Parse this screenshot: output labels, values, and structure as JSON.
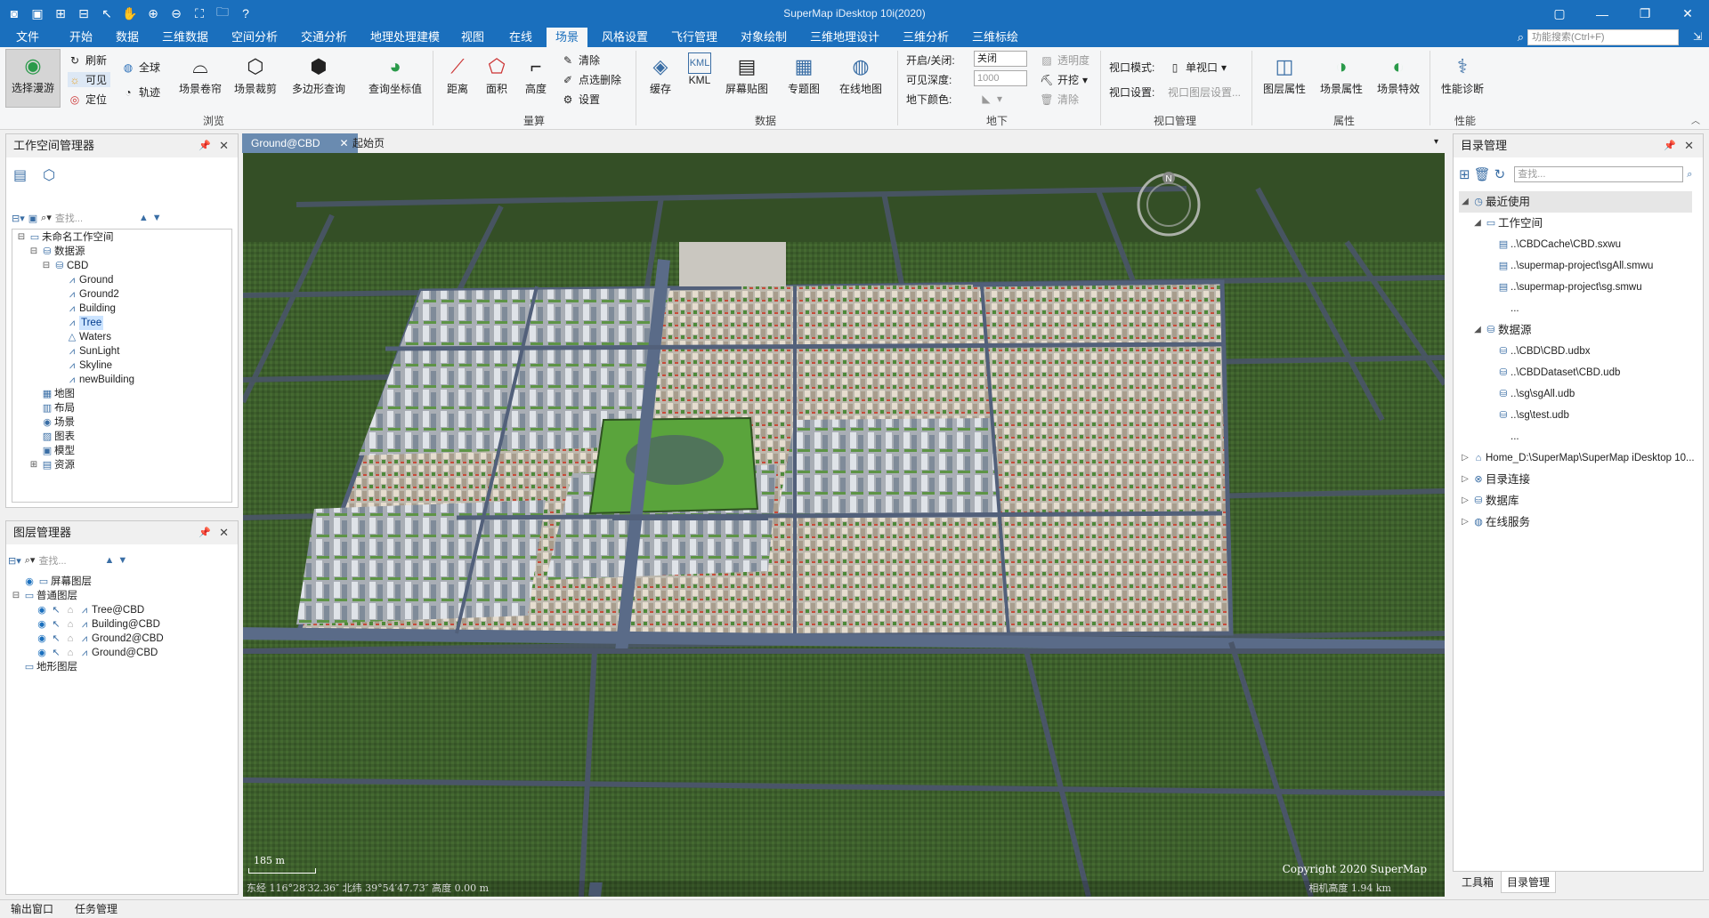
{
  "title": "SuperMap iDesktop 10i(2020)",
  "menu": [
    "文件",
    "开始",
    "数据",
    "三维数据",
    "空间分析",
    "交通分析",
    "地理处理建模",
    "视图",
    "在线",
    "场景",
    "风格设置",
    "飞行管理",
    "对象绘制",
    "三维地理设计",
    "三维分析",
    "三维标绘"
  ],
  "active_menu": "场景",
  "search_placeholder": "功能搜索(Ctrl+F)",
  "ribbon": {
    "browse": {
      "select_roam": "选择漫游",
      "refresh": "刷新",
      "visible": "可见",
      "locate": "定位",
      "globe": "全球",
      "track": "轨迹",
      "scene_roll": "场景卷帘",
      "scene_clip": "场景裁剪",
      "polygon_query": "多边形查询",
      "query_coord": "查询坐标值",
      "group": "浏览"
    },
    "measure": {
      "distance": "距离",
      "area": "面积",
      "height": "高度",
      "clear": "清除",
      "clear_point": "点选删除",
      "settings": "设置",
      "group": "量算"
    },
    "data": {
      "cache": "缓存",
      "kml": "KML",
      "screen_map": "屏幕贴图",
      "thematic": "专题图",
      "online_map": "在线地图",
      "group": "数据"
    },
    "underground": {
      "toggle_label": "开启/关闭:",
      "toggle_value": "关闭",
      "depth_label": "可见深度:",
      "depth_value": "1000",
      "color_label": "地下颜色:",
      "transparency": "透明度",
      "excavate": "开挖",
      "clear": "清除",
      "group": "地下"
    },
    "viewport": {
      "mode_label": "视口模式:",
      "mode_value": "单视口",
      "settings_label": "视口设置:",
      "settings_value": "视口图层设置...",
      "group": "视口管理"
    },
    "props": {
      "layer_props": "图层属性",
      "scene_props": "场景属性",
      "scene_effects": "场景特效",
      "group": "属性"
    },
    "perf": {
      "diagnose": "性能诊断",
      "group": "性能"
    }
  },
  "workspace": {
    "title": "工作空间管理器",
    "search_placeholder": "查找...",
    "root": "未命名工作空间",
    "datasources": "数据源",
    "cbd": "CBD",
    "datasets": [
      "Ground",
      "Ground2",
      "Building",
      "Tree",
      "Waters",
      "SunLight",
      "Skyline",
      "newBuilding"
    ],
    "selected": "Tree",
    "others": [
      "地图",
      "布局",
      "场景",
      "图表",
      "模型",
      "资源"
    ]
  },
  "layers": {
    "title": "图层管理器",
    "search_placeholder": "查找...",
    "screen_layers": "屏幕图层",
    "normal_layers": "普通图层",
    "items": [
      "Tree@CBD",
      "Building@CBD",
      "Ground2@CBD",
      "Ground@CBD"
    ],
    "terrain_layers": "地形图层"
  },
  "doc_tabs": [
    "Ground@CBD",
    "起始页"
  ],
  "scene": {
    "copyright": "Copyright 2020 SuperMap",
    "coords": "东经 116°28′32.36″   北纬 39°54′47.73″   高度 0.00 m",
    "cam_height": "相机高度 1.94 km",
    "scale": "185 m",
    "compass": "N"
  },
  "catalog": {
    "title": "目录管理",
    "search_placeholder": "查找...",
    "recent": "最近使用",
    "workspace": "工作空间",
    "ws_items": [
      "..\\CBDCache\\CBD.sxwu",
      "..\\supermap-project\\sgAll.smwu",
      "..\\supermap-project\\sg.smwu",
      "..."
    ],
    "datasource": "数据源",
    "ds_items": [
      "..\\CBD\\CBD.udbx",
      "..\\CBDDataset\\CBD.udb",
      "..\\sg\\sgAll.udb",
      "..\\sg\\test.udb",
      "..."
    ],
    "home": "Home_D:\\SuperMap\\SuperMap iDesktop 10...",
    "catalog_link": "目录连接",
    "database": "数据库",
    "online": "在线服务",
    "tabs": [
      "工具箱",
      "目录管理"
    ]
  },
  "status": [
    "输出窗口",
    "任务管理"
  ]
}
